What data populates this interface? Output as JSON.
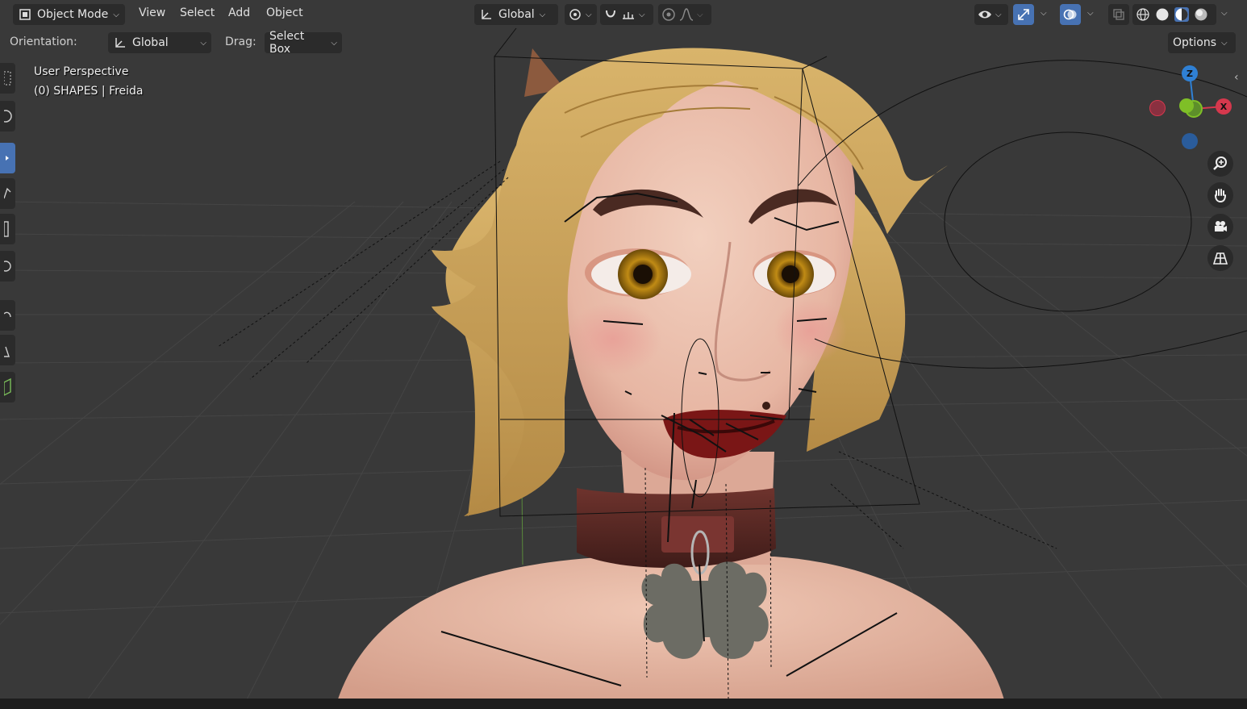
{
  "header": {
    "mode_select": {
      "label": "Object Mode"
    },
    "menus": [
      {
        "id": "view",
        "label": "View"
      },
      {
        "id": "select",
        "label": "Select"
      },
      {
        "id": "add",
        "label": "Add"
      },
      {
        "id": "object",
        "label": "Object"
      }
    ],
    "transform_orientation": {
      "label": "Global"
    },
    "icons": [
      "pivot-point-icon",
      "snap-icon",
      "snap-increment-icon",
      "proportional-edit-icon",
      "falloff-curve-icon",
      "visibility-eye-icon",
      "gizmo-icon",
      "overlays-icon",
      "xray-icon",
      "shading-wireframe-icon",
      "shading-solid-icon",
      "shading-material-icon",
      "shading-rendered-icon"
    ]
  },
  "tool_header": {
    "orientation_label": "Orientation:",
    "orientation_value": "Global",
    "drag_label": "Drag:",
    "drag_value": "Select Box",
    "options_label": "Options"
  },
  "viewport": {
    "view_name": "User Perspective",
    "object_info": "(0) SHAPES | Freida"
  },
  "gizmo": {
    "axes": [
      "Z",
      "X"
    ],
    "colors": {
      "x": "#d5384d",
      "y": "#7fbf27",
      "z": "#2f80d4"
    }
  },
  "nav_buttons": [
    "zoom-icon",
    "hand-pan-icon",
    "camera-icon",
    "orthographic-grid-icon"
  ],
  "left_tools": [
    "select-box-icon",
    "cursor-icon",
    "move-icon",
    "rotate-icon",
    "scale-icon",
    "transform-icon",
    "annotate-icon",
    "measure-icon",
    "add-cube-icon"
  ],
  "colors": {
    "viewport_bg": "#393939",
    "header_bg": "#2b2b2b",
    "accent": "#4772b3",
    "skin": "#e3b7a3",
    "hair": "#c9a45e",
    "collar": "#5a2a26",
    "tag": "#6c6c64",
    "lips": "#7a1616",
    "iris": "#b07a10"
  }
}
